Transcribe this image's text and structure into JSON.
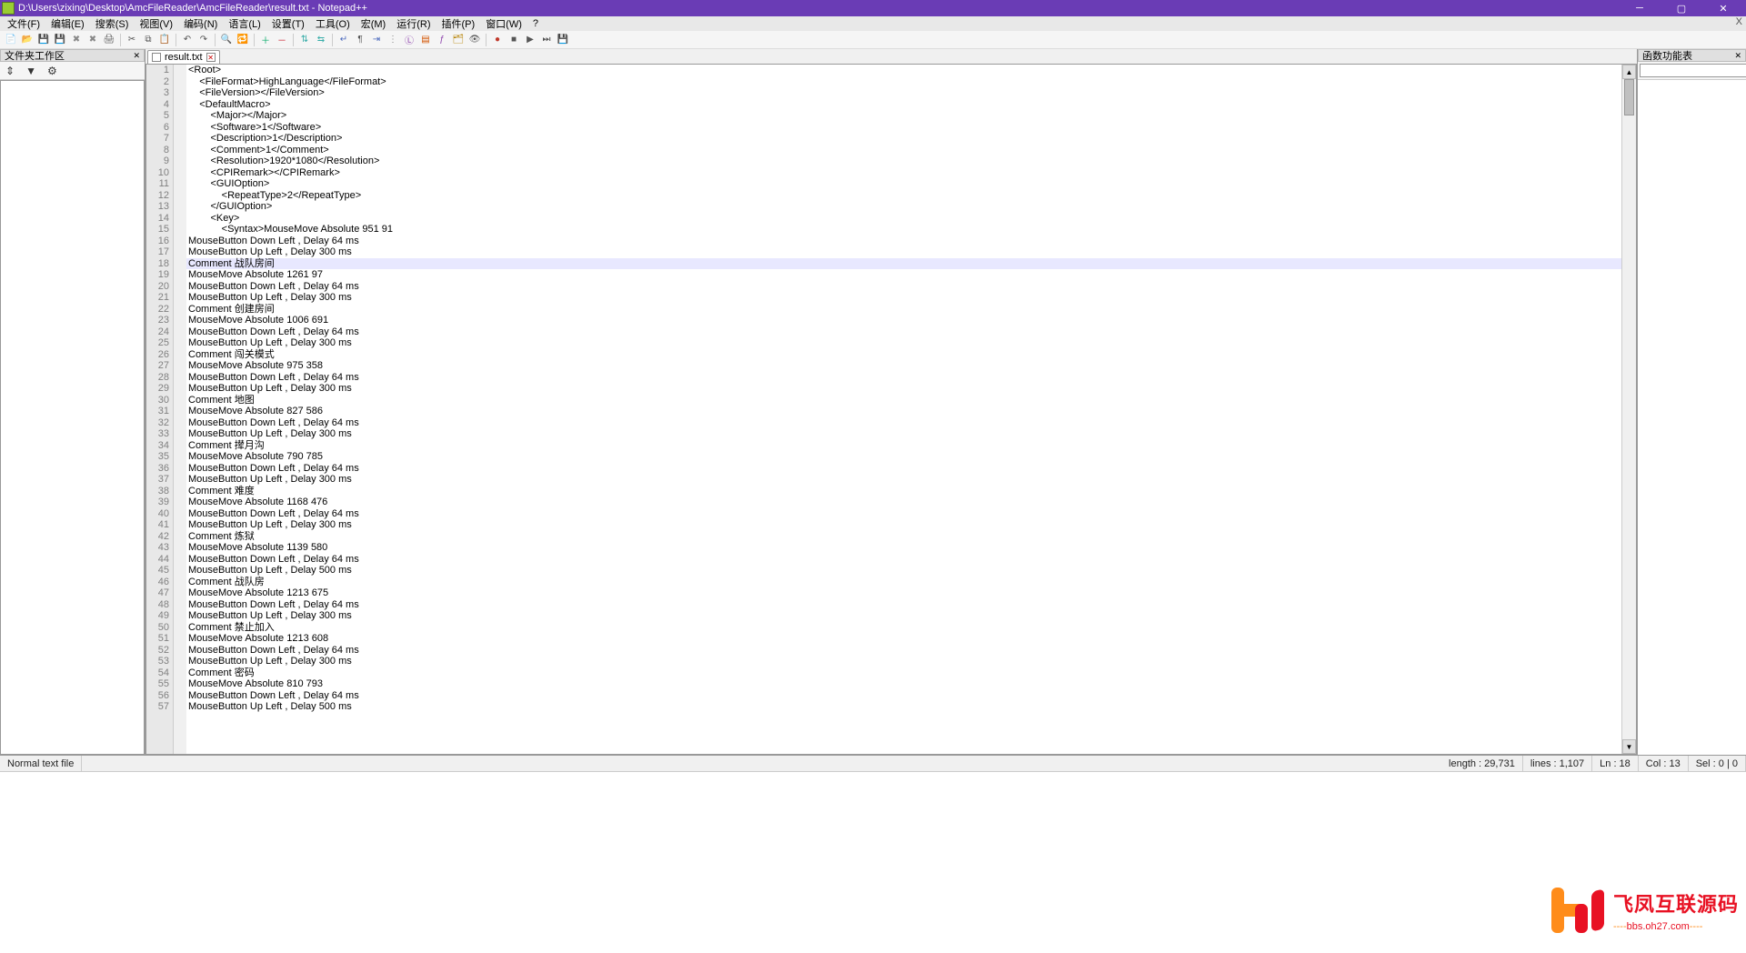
{
  "window": {
    "title": "D:\\Users\\zixing\\Desktop\\AmcFileReader\\AmcFileReader\\result.txt - Notepad++"
  },
  "menus": [
    "文件(F)",
    "编辑(E)",
    "搜索(S)",
    "视图(V)",
    "编码(N)",
    "语言(L)",
    "设置(T)",
    "工具(O)",
    "宏(M)",
    "运行(R)",
    "插件(P)",
    "窗口(W)",
    "?"
  ],
  "left_panel": {
    "title": "文件夹工作区"
  },
  "right_panel": {
    "title": "函数功能表",
    "search_placeholder": ""
  },
  "tab": {
    "label": "result.txt"
  },
  "code_lines": [
    "<Root>",
    "    <FileFormat>HighLanguage</FileFormat>",
    "    <FileVersion></FileVersion>",
    "    <DefaultMacro>",
    "        <Major></Major>",
    "        <Software>1</Software>",
    "        <Description>1</Description>",
    "        <Comment>1</Comment>",
    "        <Resolution>1920*1080</Resolution>",
    "        <CPIRemark></CPIRemark>",
    "        <GUIOption>",
    "            <RepeatType>2</RepeatType>",
    "        </GUIOption>",
    "        <Key>",
    "            <Syntax>MouseMove Absolute 951 91",
    "MouseButton Down Left , Delay 64 ms",
    "MouseButton Up Left , Delay 300 ms",
    "Comment 战队房间",
    "MouseMove Absolute 1261 97",
    "MouseButton Down Left , Delay 64 ms",
    "MouseButton Up Left , Delay 300 ms",
    "Comment 创建房间",
    "MouseMove Absolute 1006 691",
    "MouseButton Down Left , Delay 64 ms",
    "MouseButton Up Left , Delay 300 ms",
    "Comment 闯关模式",
    "MouseMove Absolute 975 358",
    "MouseButton Down Left , Delay 64 ms",
    "MouseButton Up Left , Delay 300 ms",
    "Comment 地图",
    "MouseMove Absolute 827 586",
    "MouseButton Down Left , Delay 64 ms",
    "MouseButton Up Left , Delay 300 ms",
    "Comment 撵月沟",
    "MouseMove Absolute 790 785",
    "MouseButton Down Left , Delay 64 ms",
    "MouseButton Up Left , Delay 300 ms",
    "Comment 难度",
    "MouseMove Absolute 1168 476",
    "MouseButton Down Left , Delay 64 ms",
    "MouseButton Up Left , Delay 300 ms",
    "Comment 炼狱",
    "MouseMove Absolute 1139 580",
    "MouseButton Down Left , Delay 64 ms",
    "MouseButton Up Left , Delay 500 ms",
    "Comment 战队房",
    "MouseMove Absolute 1213 675",
    "MouseButton Down Left , Delay 64 ms",
    "MouseButton Up Left , Delay 300 ms",
    "Comment 禁止加入",
    "MouseMove Absolute 1213 608",
    "MouseButton Down Left , Delay 64 ms",
    "MouseButton Up Left , Delay 300 ms",
    "Comment 密码",
    "MouseMove Absolute 810 793",
    "MouseButton Down Left , Delay 64 ms",
    "MouseButton Up Left , Delay 500 ms"
  ],
  "highlight_line_index": 17,
  "status": {
    "filetype": "Normal text file",
    "length": "length : 29,731",
    "lines": "lines : 1,107",
    "ln": "Ln : 18",
    "col": "Col : 13",
    "sel": "Sel : 0 | 0"
  },
  "watermark": {
    "cn": "飞凤互联源码",
    "url": "bbs.oh27.com",
    "dashes": "----"
  },
  "toolbar_icons": [
    {
      "n": "new-file-icon",
      "g": "📄",
      "c": "#6ab04c"
    },
    {
      "n": "open-icon",
      "g": "📂",
      "c": "#d4a017"
    },
    {
      "n": "save-icon",
      "g": "💾",
      "c": "#4a69bd"
    },
    {
      "n": "save-all-icon",
      "g": "💾",
      "c": "#4a69bd"
    },
    {
      "n": "close-icon",
      "g": "✖",
      "c": "#888"
    },
    {
      "n": "close-all-icon",
      "g": "✖",
      "c": "#888"
    },
    {
      "n": "print-icon",
      "g": "🖨",
      "c": "#555"
    },
    {
      "n": "sep"
    },
    {
      "n": "cut-icon",
      "g": "✂",
      "c": "#555"
    },
    {
      "n": "copy-icon",
      "g": "⧉",
      "c": "#555"
    },
    {
      "n": "paste-icon",
      "g": "📋",
      "c": "#555"
    },
    {
      "n": "sep"
    },
    {
      "n": "undo-icon",
      "g": "↶",
      "c": "#555"
    },
    {
      "n": "redo-icon",
      "g": "↷",
      "c": "#555"
    },
    {
      "n": "sep"
    },
    {
      "n": "find-icon",
      "g": "🔍",
      "c": "#1e3799"
    },
    {
      "n": "replace-icon",
      "g": "🔁",
      "c": "#1e3799"
    },
    {
      "n": "sep"
    },
    {
      "n": "zoom-in-icon",
      "g": "＋",
      "c": "#0a6"
    },
    {
      "n": "zoom-out-icon",
      "g": "－",
      "c": "#c23"
    },
    {
      "n": "sep"
    },
    {
      "n": "sync-v-icon",
      "g": "⇅",
      "c": "#38ada9"
    },
    {
      "n": "sync-h-icon",
      "g": "⇆",
      "c": "#38ada9"
    },
    {
      "n": "sep"
    },
    {
      "n": "wrap-icon",
      "g": "↵",
      "c": "#4a69bd"
    },
    {
      "n": "all-chars-icon",
      "g": "¶",
      "c": "#555"
    },
    {
      "n": "indent-icon",
      "g": "⇥",
      "c": "#4a69bd"
    },
    {
      "n": "guide-icon",
      "g": "⋮",
      "c": "#888"
    },
    {
      "n": "lang-icon",
      "g": "Ⓛ",
      "c": "#8e44ad"
    },
    {
      "n": "doc-map-icon",
      "g": "▤",
      "c": "#d35400"
    },
    {
      "n": "func-list-icon",
      "g": "ƒ",
      "c": "#8e44ad"
    },
    {
      "n": "folder-ws-icon",
      "g": "🗂",
      "c": "#b8860b"
    },
    {
      "n": "monitor-icon",
      "g": "👁",
      "c": "#555"
    },
    {
      "n": "sep"
    },
    {
      "n": "record-icon",
      "g": "●",
      "c": "#c0392b"
    },
    {
      "n": "stop-icon",
      "g": "■",
      "c": "#555"
    },
    {
      "n": "play-icon",
      "g": "▶",
      "c": "#555"
    },
    {
      "n": "play-multi-icon",
      "g": "⏭",
      "c": "#555"
    },
    {
      "n": "save-macro-icon",
      "g": "💾",
      "c": "#555"
    }
  ]
}
